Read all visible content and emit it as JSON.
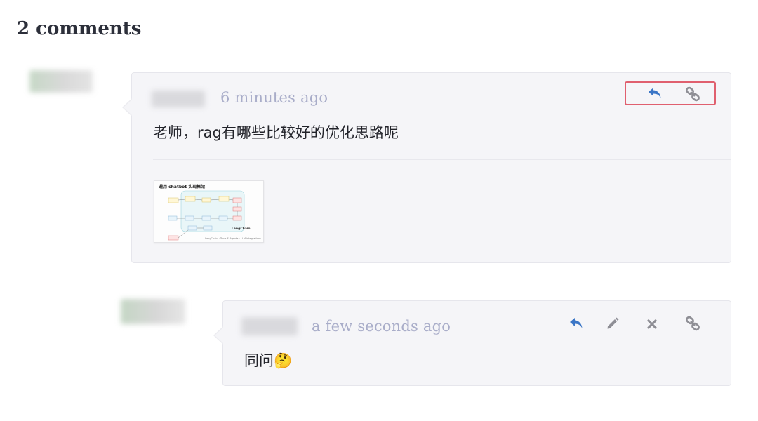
{
  "comments_heading": "2 comments",
  "comments": [
    {
      "time": "6 minutes ago",
      "text": "老师，rag有哪些比较好的优化思路呢",
      "attachment": {
        "title": "通用 chatbot 实现框架",
        "footer": "LangChain · Tools & Agents · LLM integrations",
        "brand": "LangChain"
      },
      "actions": [
        "reply-icon",
        "link-icon"
      ]
    },
    {
      "time": "a few seconds ago",
      "text": "同问🤔",
      "actions": [
        "reply-icon",
        "edit-icon",
        "delete-icon",
        "link-icon"
      ]
    }
  ],
  "colors": {
    "accent_blue": "#3b76c6",
    "icon_gray": "#8e8e95",
    "highlight_red": "#e0606f",
    "timestamp": "#a9adc9"
  }
}
